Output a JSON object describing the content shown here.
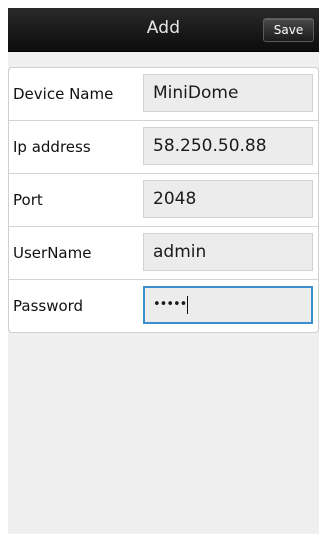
{
  "header": {
    "title": "Add",
    "save_label": "Save"
  },
  "form": {
    "fields": [
      {
        "label": "Device Name",
        "value": "MiniDome"
      },
      {
        "label": "Ip address",
        "value": "58.250.50.88"
      },
      {
        "label": "Port",
        "value": "2048"
      },
      {
        "label": "UserName",
        "value": "admin"
      },
      {
        "label": "Password",
        "value": "•••••"
      }
    ]
  },
  "colors": {
    "titlebar": "#111111",
    "focus_border": "#3b8fcc",
    "field_bg": "#ececec"
  }
}
